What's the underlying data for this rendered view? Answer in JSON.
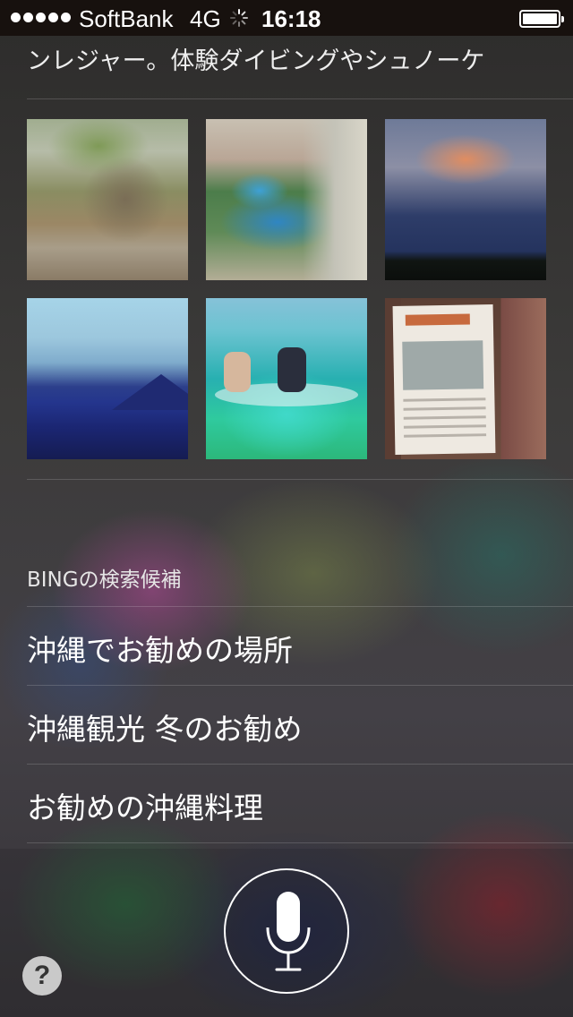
{
  "status_bar": {
    "carrier": "SoftBank",
    "network": "4G",
    "time": "16:18"
  },
  "answer": {
    "snippet_text": "ンレジャー。体験ダイビングやシュノーケ",
    "photos": [
      {
        "name": "coastal-rock-photo"
      },
      {
        "name": "resort-pool-photo"
      },
      {
        "name": "sunset-cloud-photo"
      },
      {
        "name": "mountain-view-photo"
      },
      {
        "name": "kayak-photo"
      },
      {
        "name": "craft-poster-photo"
      }
    ]
  },
  "bing": {
    "header": "BINGの検索候補",
    "suggestions": [
      "沖縄でお勧めの場所",
      "沖縄観光 冬のお勧め",
      "お勧めの沖縄料理"
    ]
  },
  "controls": {
    "help_label": "?"
  }
}
